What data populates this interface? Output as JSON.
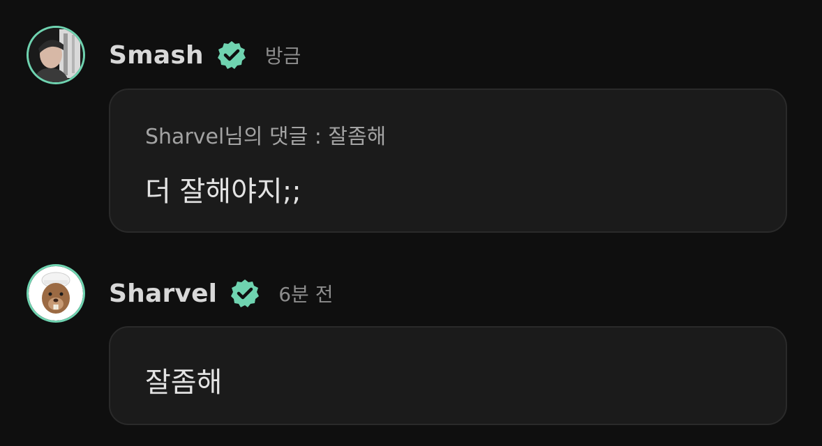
{
  "comments": [
    {
      "username": "Smash",
      "time": "방금",
      "reply_to": "Sharvel님의 댓글 : 잘좀해",
      "text": "더 잘해야지;;"
    },
    {
      "username": "Sharvel",
      "time": "6분 전",
      "text": "잘좀해"
    }
  ],
  "icons": {
    "verified": "verified-badge-icon",
    "avatar_1": "user-photo-avatar",
    "avatar_2": "beaver-avatar"
  },
  "colors": {
    "background": "#0f0f0f",
    "accent": "#6fd3b0",
    "bubble": "#1b1b1b",
    "muted_text": "#8d8d8d"
  }
}
